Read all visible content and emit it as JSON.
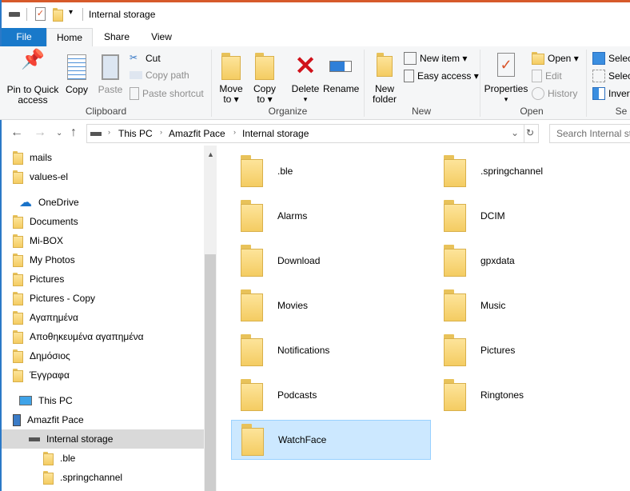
{
  "window": {
    "title": "Internal storage"
  },
  "tabs": [
    "File",
    "Home",
    "Share",
    "View"
  ],
  "ribbon": {
    "clipboard": {
      "label": "Clipboard",
      "pin": "Pin to Quick access",
      "pin1": "Pin to Quick",
      "pin2": "access",
      "copy": "Copy",
      "paste": "Paste",
      "cut": "Cut",
      "copy_path": "Copy path",
      "paste_shortcut": "Paste shortcut"
    },
    "organize": {
      "label": "Organize",
      "move1": "Move",
      "move2": "to ▾",
      "copy1": "Copy",
      "copy2": "to ▾",
      "delete": "Delete",
      "delete_arrow": "▾",
      "rename": "Rename"
    },
    "new": {
      "label": "New",
      "new_folder1": "New",
      "new_folder2": "folder",
      "new_item": "New item ▾",
      "easy_access": "Easy access ▾"
    },
    "open": {
      "label": "Open",
      "properties": "Properties",
      "properties_arrow": "▾",
      "open": "Open ▾",
      "edit": "Edit",
      "history": "History"
    },
    "select": {
      "label": "Se",
      "select_all": "Select",
      "select_none": "Select",
      "invert": "Invert"
    }
  },
  "address": {
    "crumbs": [
      "This PC",
      "Amazfit Pace",
      "Internal storage"
    ],
    "search_placeholder": "Search Internal storage"
  },
  "sidebar": [
    {
      "label": "mails",
      "type": "folder",
      "indent": 1
    },
    {
      "label": "values-el",
      "type": "folder",
      "indent": 1
    },
    {
      "label": "OneDrive",
      "type": "onedrive",
      "indent": 0
    },
    {
      "label": "Documents",
      "type": "folder",
      "indent": 1
    },
    {
      "label": "Mi-BOX",
      "type": "folder",
      "indent": 1
    },
    {
      "label": "My Photos",
      "type": "folder",
      "indent": 1
    },
    {
      "label": "Pictures",
      "type": "folder",
      "indent": 1
    },
    {
      "label": "Pictures - Copy",
      "type": "folder",
      "indent": 1
    },
    {
      "label": "Αγαπημένα",
      "type": "folder",
      "indent": 1
    },
    {
      "label": "Αποθηκευμένα αγαπημένα",
      "type": "folder",
      "indent": 1
    },
    {
      "label": "Δημόσιος",
      "type": "folder",
      "indent": 1
    },
    {
      "label": "Έγγραφα",
      "type": "folder",
      "indent": 1
    },
    {
      "label": "This PC",
      "type": "pc",
      "indent": 0
    },
    {
      "label": "Amazfit Pace",
      "type": "device",
      "indent": 1
    },
    {
      "label": "Internal storage",
      "type": "drive",
      "indent": 2,
      "selected": true
    },
    {
      "label": ".ble",
      "type": "folder",
      "indent": 3
    },
    {
      "label": ".springchannel",
      "type": "folder",
      "indent": 3
    }
  ],
  "files": [
    ".ble",
    ".springchannel",
    "Alarms",
    "DCIM",
    "Download",
    "gpxdata",
    "Movies",
    "Music",
    "Notifications",
    "Pictures",
    "Podcasts",
    "Ringtones",
    "WatchFace"
  ],
  "selected_file": "WatchFace"
}
